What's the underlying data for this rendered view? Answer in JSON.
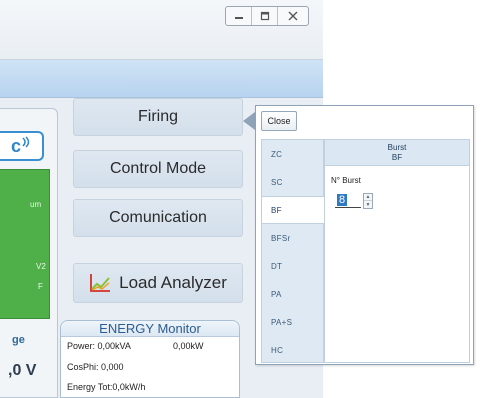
{
  "window": {
    "controls": {
      "minimize": "▭",
      "maximize": "◫",
      "close": "⌧"
    }
  },
  "left_panel": {
    "logo_text": "c",
    "green_text_1": "um",
    "green_text_2": "V2",
    "green_text_3": "F",
    "label": "ge",
    "value": ",0 V"
  },
  "menu": {
    "firing": "Firing",
    "control_mode": "Control Mode",
    "communication": "Comunication",
    "load_analyzer": "Load Analyzer"
  },
  "energy_monitor": {
    "title": "ENERGY Monitor",
    "power": "Power: 0,00kVA",
    "power_kw": "0,00kW",
    "cosphi": "CosPhi: 0,000",
    "energy_tot": "Energy Tot:0,0kW/h"
  },
  "popup": {
    "close_label": "Close",
    "modes": [
      "ZC",
      "SC",
      "BF",
      "BFSr",
      "DT",
      "PA",
      "PA+S",
      "HC"
    ],
    "active_mode": "BF",
    "detail_title": "Burst",
    "detail_subtitle": "BF",
    "burst_label": "N° Burst",
    "burst_value": "8"
  },
  "colors": {
    "green_block": "#4fb04a",
    "accent_blue": "#2f86c8",
    "selection": "#2f78c4"
  }
}
